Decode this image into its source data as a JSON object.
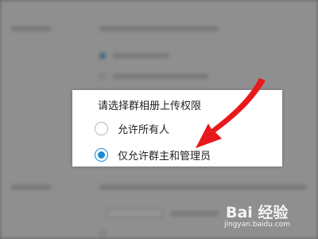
{
  "popup": {
    "title": "请选择群相册上传权限",
    "options": [
      {
        "label": "允许所有人",
        "selected": false
      },
      {
        "label": "仅允许群主和管理员",
        "selected": true
      }
    ]
  },
  "accent_color": "#1b8bd6",
  "arrow_color": "#e8191c",
  "watermark": {
    "brand": "Bai 经验",
    "url": "jingyan.baidu.com"
  }
}
